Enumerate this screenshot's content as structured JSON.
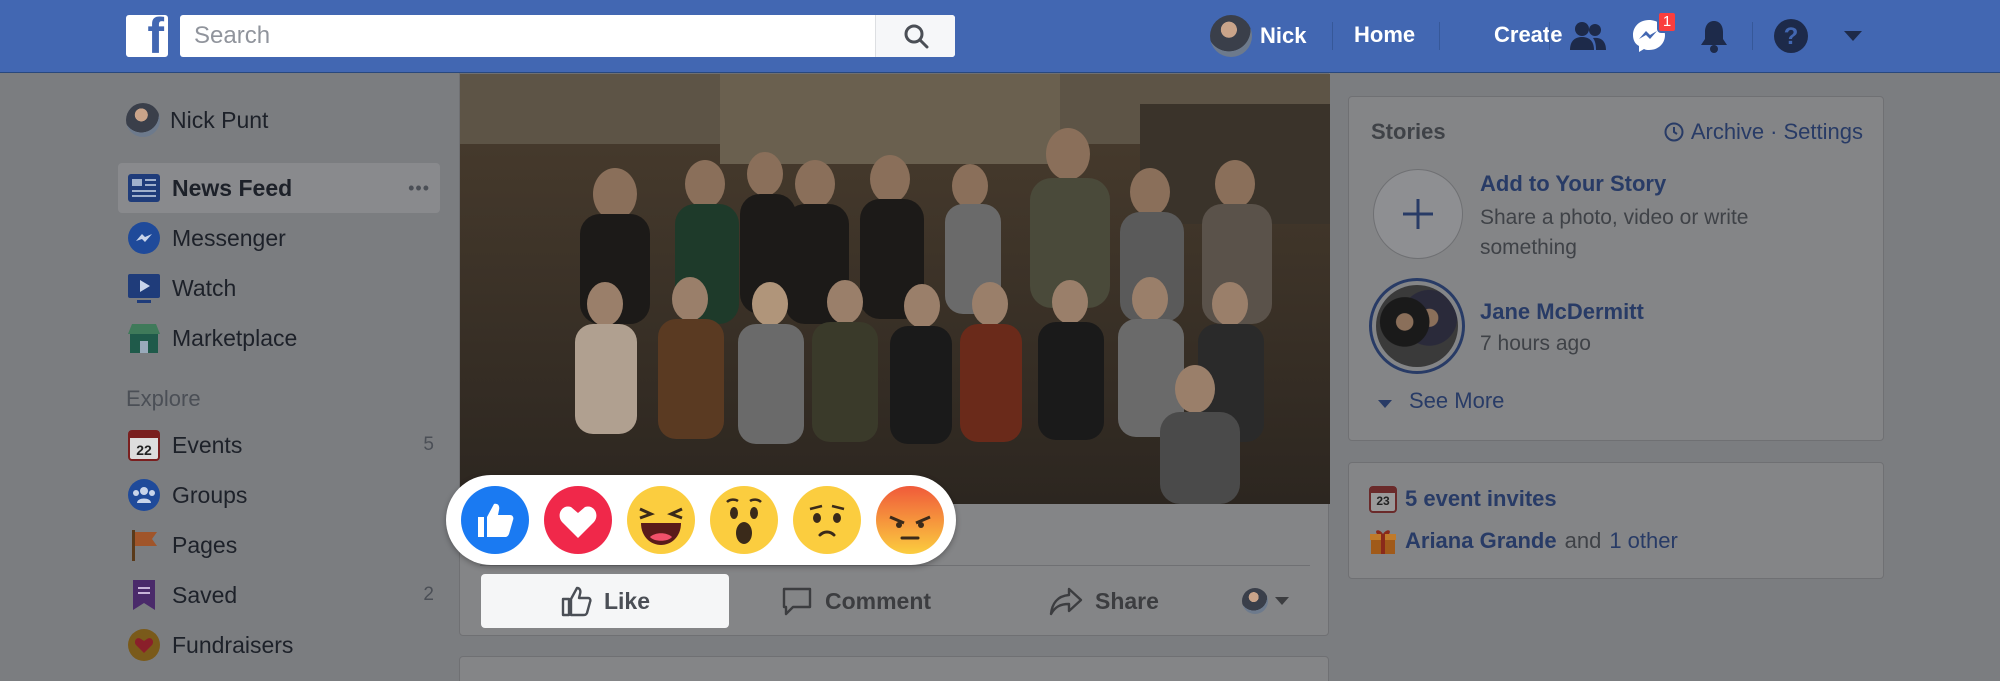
{
  "topbar": {
    "logo": "f",
    "search_placeholder": "Search",
    "profile_name": "Nick",
    "home": "Home",
    "create": "Create",
    "messenger_badge": "1"
  },
  "sidebar": {
    "profile": "Nick Punt",
    "items": [
      {
        "label": "News Feed",
        "more": "•••"
      },
      {
        "label": "Messenger"
      },
      {
        "label": "Watch"
      },
      {
        "label": "Marketplace"
      }
    ],
    "explore_title": "Explore",
    "explore": [
      {
        "label": "Events",
        "count": "5",
        "date": "22"
      },
      {
        "label": "Groups"
      },
      {
        "label": "Pages"
      },
      {
        "label": "Saved",
        "count": "2"
      },
      {
        "label": "Fundraisers"
      }
    ]
  },
  "post": {
    "like": "Like",
    "comment": "Comment",
    "share": "Share",
    "reactions": [
      "like",
      "love",
      "haha",
      "wow",
      "sad",
      "angry"
    ]
  },
  "stories": {
    "title": "Stories",
    "archive": "Archive",
    "dot": "·",
    "settings": "Settings",
    "add_title": "Add to Your Story",
    "add_sub": "Share a photo, video or write something",
    "story_name": "Jane McDermitt",
    "story_time": "7 hours ago",
    "see_more": "See More"
  },
  "events": {
    "date": "23",
    "invites": "5 event invites",
    "birthday_name": "Ariana Grande",
    "and": "and",
    "other": "1 other"
  }
}
